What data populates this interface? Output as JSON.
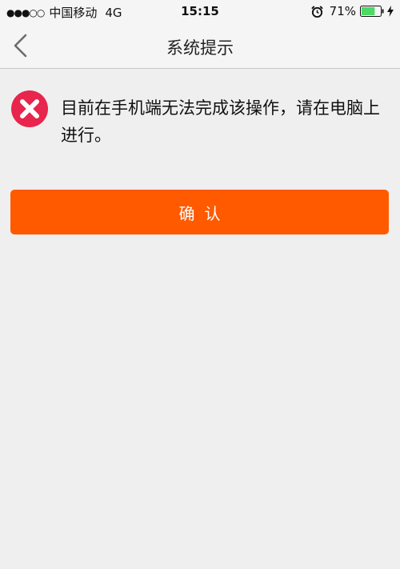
{
  "status_bar": {
    "signal": "●●●○○",
    "carrier": "中国移动",
    "network": "4G",
    "time": "15:15",
    "battery_percent": "71%",
    "battery_level": 0.71,
    "icons": [
      "alarm-icon",
      "battery-icon",
      "charging-icon"
    ]
  },
  "nav": {
    "back_icon": "chevron-left-icon",
    "title": "系统提示"
  },
  "message": {
    "icon": "error-icon",
    "text": "目前在手机端无法完成该操作，请在电脑上进行。"
  },
  "confirm_label": "确认",
  "colors": {
    "accent": "#ff5a00",
    "error": "#e8254c",
    "battery": "#4cd964",
    "background": "#efeff0"
  }
}
